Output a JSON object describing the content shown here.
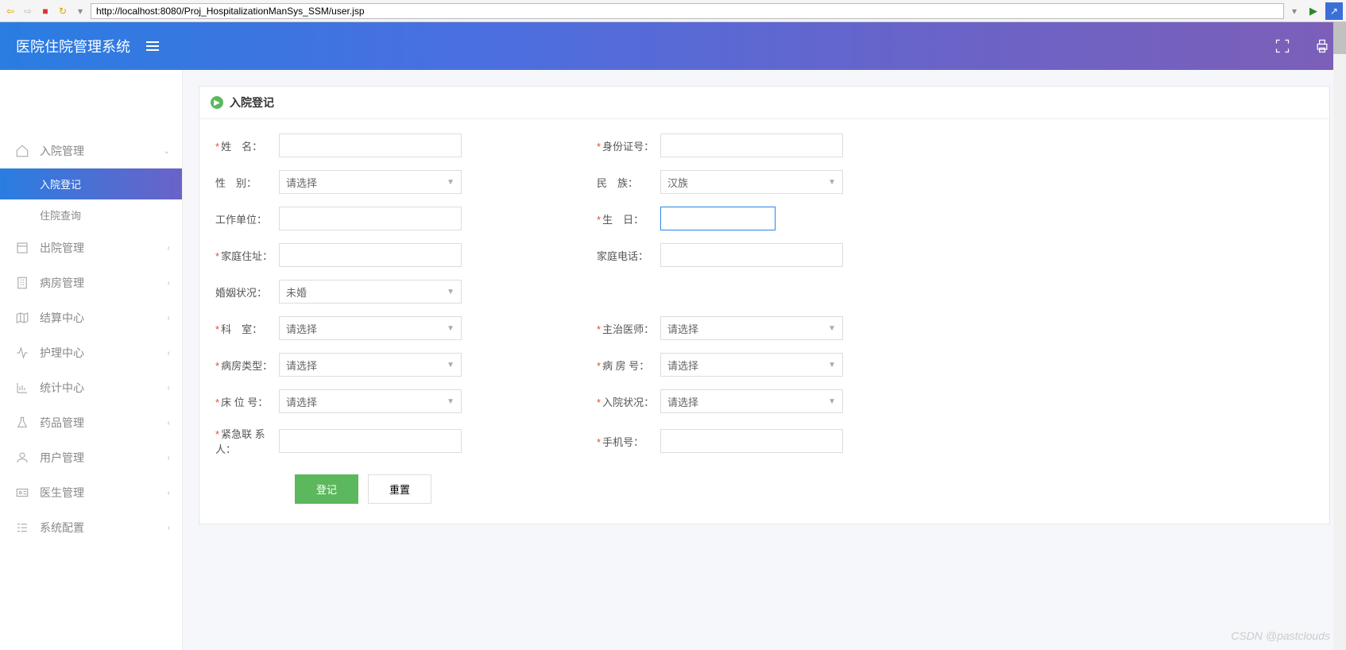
{
  "browser": {
    "url": "http://localhost:8080/Proj_HospitalizationManSys_SSM/user.jsp"
  },
  "header": {
    "title": "医院住院管理系统"
  },
  "sidebar": {
    "items": [
      {
        "label": "入院管理",
        "icon": "home"
      },
      {
        "label": "出院管理",
        "icon": "discharge"
      },
      {
        "label": "病房管理",
        "icon": "ward"
      },
      {
        "label": "结算中心",
        "icon": "billing"
      },
      {
        "label": "护理中心",
        "icon": "care"
      },
      {
        "label": "统计中心",
        "icon": "stats"
      },
      {
        "label": "药品管理",
        "icon": "drugs"
      },
      {
        "label": "用户管理",
        "icon": "user"
      },
      {
        "label": "医生管理",
        "icon": "doctor"
      },
      {
        "label": "系统配置",
        "icon": "config"
      }
    ],
    "sub": {
      "admit_register": "入院登记",
      "admit_query": "住院查询"
    }
  },
  "panel": {
    "title": "入院登记"
  },
  "form": {
    "name_label": "姓　名：",
    "id_label": "身份证号：",
    "gender_label": "性　别：",
    "gender_value": "请选择",
    "nation_label": "民　族：",
    "nation_value": "汉族",
    "work_label": "工作单位：",
    "birth_label": "生　日：",
    "addr_label": "家庭住址：",
    "phone_label": "家庭电话：",
    "marriage_label": "婚姻状况：",
    "marriage_value": "未婚",
    "dept_label": "科　室：",
    "dept_value": "请选择",
    "doctor_label": "主治医师：",
    "doctor_value": "请选择",
    "wardtype_label": "病房类型：",
    "wardtype_value": "请选择",
    "wardno_label": "病 房 号：",
    "wardno_value": "请选择",
    "bedno_label": "床 位 号：",
    "bedno_value": "请选择",
    "status_label": "入院状况：",
    "status_value": "请选择",
    "contact_label": "紧急联 系人：",
    "mobile_label": "手机号："
  },
  "buttons": {
    "submit": "登记",
    "reset": "重置"
  },
  "watermark": "CSDN @pastclouds"
}
